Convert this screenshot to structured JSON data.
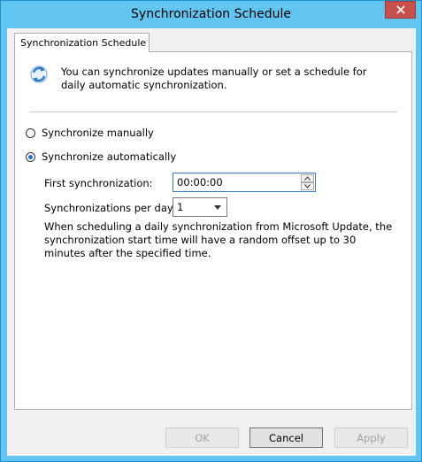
{
  "window": {
    "title": "Synchronization Schedule"
  },
  "tab": {
    "label": "Synchronization Schedule"
  },
  "intro": {
    "text": "You can synchronize updates manually or set a schedule for daily automatic synchronization."
  },
  "options": {
    "manual_label": "Synchronize manually",
    "auto_label": "Synchronize automatically",
    "selected": "auto"
  },
  "first_sync": {
    "label": "First synchronization:",
    "value": "00:00:00"
  },
  "per_day": {
    "label": "Synchronizations per day:",
    "value": "1"
  },
  "note": {
    "text": "When scheduling a daily synchronization from Microsoft Update, the synchronization start time will have a random offset up to 30 minutes after the specified time."
  },
  "buttons": {
    "ok": "OK",
    "cancel": "Cancel",
    "apply": "Apply"
  },
  "icons": {
    "close": "close-icon",
    "sync": "sync-icon",
    "up": "chevron-up-icon",
    "down": "chevron-down-icon"
  }
}
